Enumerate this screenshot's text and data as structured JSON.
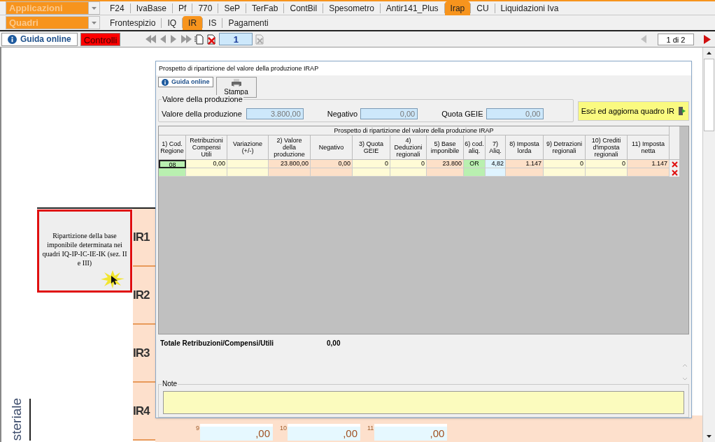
{
  "applicazioni": {
    "label": "Applicazioni"
  },
  "app_tabs": [
    {
      "label": "F24",
      "selected": false
    },
    {
      "label": "IvaBase",
      "selected": false
    },
    {
      "label": "Pf",
      "selected": false
    },
    {
      "label": "770",
      "selected": false
    },
    {
      "label": "SeP",
      "selected": false
    },
    {
      "label": "TerFab",
      "selected": false
    },
    {
      "label": "ContBil",
      "selected": false
    },
    {
      "label": "Spesometro",
      "selected": false
    },
    {
      "label": "Antir141_Plus",
      "selected": false
    },
    {
      "label": "Irap",
      "selected": true
    },
    {
      "label": "CU",
      "selected": false
    },
    {
      "label": "Liquidazioni Iva",
      "selected": false
    }
  ],
  "quadri": {
    "label": "Quadri"
  },
  "quadri_tabs": [
    {
      "label": "Frontespizio",
      "selected": false
    },
    {
      "label": "IQ",
      "selected": false
    },
    {
      "label": "IR",
      "selected": true
    },
    {
      "label": "IS",
      "selected": false
    },
    {
      "label": "Pagamenti",
      "selected": false
    }
  ],
  "toolbar": {
    "guida": "Guida online",
    "controlli": "Controlli",
    "page_number": "1",
    "pager": "1 di 2"
  },
  "form": {
    "tooltip": "Ripartizione della base imponibile determinata nei quadri IQ-IP-IC-IE-IK (sez. II e III)",
    "side_text": "steriale",
    "row_labels": [
      "IR1",
      "IR2",
      "IR3",
      "IR4"
    ],
    "bottom_fields": [
      {
        "number": "9",
        "value": ",00"
      },
      {
        "number": "10",
        "value": ",00"
      },
      {
        "number": "11",
        "value": ",00"
      }
    ]
  },
  "dialog": {
    "title": "Prospetto di ripartizione del valore della produzione IRAP",
    "guida": "Guida online",
    "stampa": "Stampa",
    "group_title": "Valore della produzione",
    "fields": [
      {
        "label": "Valore della produzione",
        "value": "3.800,00"
      },
      {
        "label": "Negativo",
        "value": "0,00"
      },
      {
        "label": "Quota GEIE",
        "value": "0,00"
      }
    ],
    "exit_button": "Esci ed aggiorna quadro IR",
    "table": {
      "caption": "Prospetto di ripartizione del valore della produzione IRAP",
      "columns": [
        {
          "label": "1) Cod. Regione",
          "kind": "code"
        },
        {
          "label": "Retribuzioni Compensi Utili",
          "kind": "input"
        },
        {
          "label": "Variazione (+/-)",
          "kind": "input"
        },
        {
          "label": "2) Valore della produzione",
          "kind": "computed"
        },
        {
          "label": "Negativo",
          "kind": "computed"
        },
        {
          "label": "3) Quota GEIE",
          "kind": "input"
        },
        {
          "label": "4) Deduzioni regionali",
          "kind": "input"
        },
        {
          "label": "5) Base imponibile",
          "kind": "computed"
        },
        {
          "label": "6) cod. aliq.",
          "kind": "code"
        },
        {
          "label": "7) Aliq.",
          "kind": "rate"
        },
        {
          "label": "8) Imposta lorda",
          "kind": "computed"
        },
        {
          "label": "9) Detrazioni regionali",
          "kind": "input"
        },
        {
          "label": "10) Crediti d'imposta regionali",
          "kind": "input"
        },
        {
          "label": "11) Imposta netta",
          "kind": "computed"
        }
      ],
      "rows": [
        {
          "cells": [
            "08",
            "0,00",
            "",
            "23.800,00",
            "0,00",
            "0",
            "0",
            "23.800",
            "OR",
            "4,82",
            "1.147",
            "0",
            "0",
            "1.147"
          ]
        },
        {
          "cells": [
            "",
            "",
            "",
            "",
            "",
            "",
            "",
            "",
            "",
            "",
            "",
            "",
            "",
            ""
          ]
        }
      ]
    },
    "total_label": "Totale Retribuzioni/Compensi/Utili",
    "total_value": "0,00",
    "note_label": "Note"
  }
}
